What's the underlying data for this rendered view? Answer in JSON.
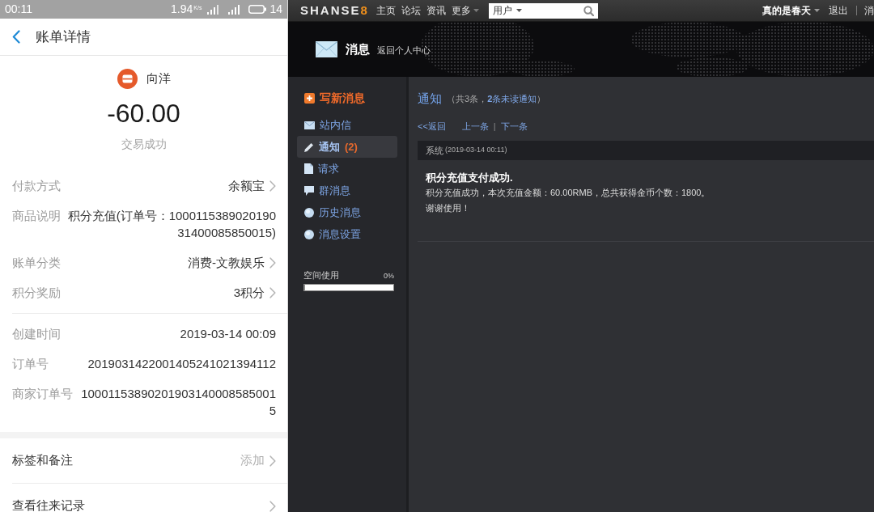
{
  "phone": {
    "status_bar": {
      "time": "00:11",
      "speed": "1.94",
      "speed_unit": "K/s",
      "battery": "14"
    },
    "header": {
      "title": "账单详情"
    },
    "summary": {
      "merchant": "向洋",
      "amount": "-60.00",
      "status": "交易成功"
    },
    "detail_groups": [
      {
        "rows": [
          {
            "label": "付款方式",
            "value": "余额宝",
            "arrow": true
          },
          {
            "label": "商品说明",
            "value": "积分充值(订单号：100011538902019031400085850015)",
            "arrow": false
          },
          {
            "label": "账单分类",
            "value": "消费-文教娱乐",
            "arrow": true
          },
          {
            "label": "积分奖励",
            "value": "3积分",
            "arrow": true
          }
        ]
      },
      {
        "rows": [
          {
            "label": "创建时间",
            "value": "2019-03-14 00:09",
            "arrow": false
          },
          {
            "label": "订单号",
            "value": "2019031422001405241021394112",
            "arrow": false
          },
          {
            "label": "商家订单号",
            "value": "100011538902019031400085850015",
            "arrow": false
          }
        ]
      }
    ],
    "actions": [
      {
        "label": "标签和备注",
        "value": "添加"
      },
      {
        "label": "查看往来记录"
      }
    ]
  },
  "site": {
    "logo": {
      "text": "SHANSE",
      "accent": "8"
    },
    "nav": [
      {
        "label": "主页",
        "dropdown": false
      },
      {
        "label": "论坛",
        "dropdown": false
      },
      {
        "label": "资讯",
        "dropdown": false
      },
      {
        "label": "更多",
        "dropdown": true
      }
    ],
    "search": {
      "scope": "用户"
    },
    "user": {
      "name": "真的是春天",
      "links": [
        "退出",
        "消"
      ]
    },
    "page_header": {
      "title": "消息",
      "link": "返回个人中心"
    },
    "sidebar": {
      "compose": "写新消息",
      "items": [
        {
          "kind": "inbox",
          "label": "站内信",
          "selected": false
        },
        {
          "kind": "notice",
          "label": "通知",
          "count": "(2)",
          "selected": true
        },
        {
          "kind": "request",
          "label": "请求",
          "selected": false
        },
        {
          "kind": "group",
          "label": "群消息",
          "selected": false
        },
        {
          "kind": "history",
          "label": "历史消息",
          "selected": false
        },
        {
          "kind": "settings",
          "label": "消息设置",
          "selected": false
        }
      ],
      "storage": {
        "label": "空间使用",
        "reading": "0%",
        "level": 0
      }
    },
    "content": {
      "title": "通知",
      "summary": {
        "prefix": "（共3条，",
        "unread": "**2**条未读通知",
        "suffix": "）"
      },
      "pager": {
        "back": "<<返回",
        "prev": "上一条",
        "separator": "|",
        "next": "下一条"
      },
      "message": {
        "sender": "系统",
        "time": "(2019-03-14 00:11)",
        "title": "积分充值支付成功.",
        "lines": [
          "积分充值成功，本次充值金额：60.00RMB，总共获得金币个数：1800。",
          "谢谢使用！"
        ]
      }
    }
  }
}
